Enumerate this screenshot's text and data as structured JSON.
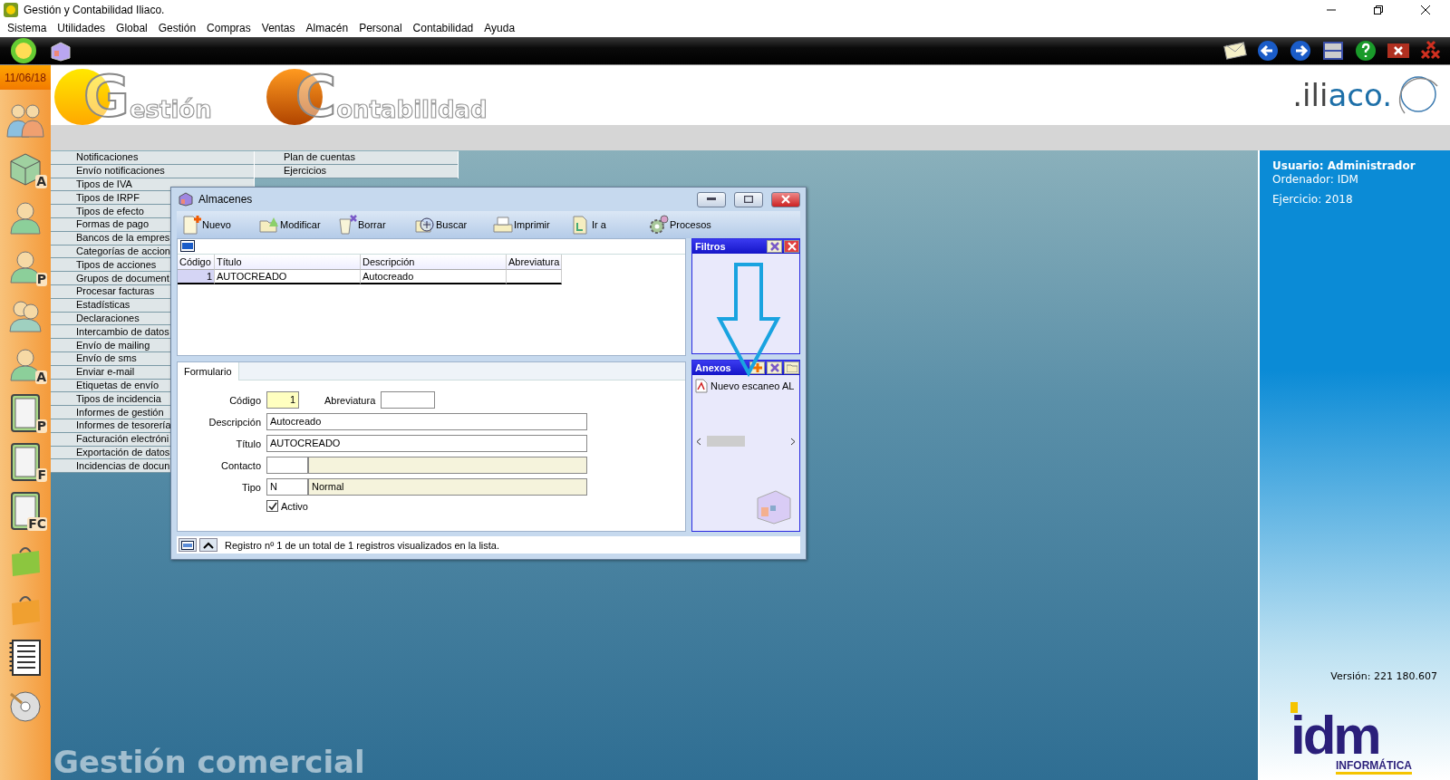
{
  "window": {
    "title": "Gestión y Contabilidad Iliaco."
  },
  "menu": [
    "Sistema",
    "Utilidades",
    "Global",
    "Gestión",
    "Compras",
    "Ventas",
    "Almacén",
    "Personal",
    "Contabilidad",
    "Ayuda"
  ],
  "date": "11/06/18",
  "sidebar_tiles": [
    {
      "kind": "group"
    },
    {
      "kind": "box",
      "letter": "A"
    },
    {
      "kind": "person"
    },
    {
      "kind": "person",
      "letter": "P"
    },
    {
      "kind": "pair"
    },
    {
      "kind": "person",
      "letter": "A"
    },
    {
      "kind": "card",
      "letter": "P"
    },
    {
      "kind": "card",
      "letter": "F"
    },
    {
      "kind": "card",
      "letter": "FC"
    },
    {
      "kind": "bag",
      "color": "#8cc63f"
    },
    {
      "kind": "bag",
      "color": "#f0a030"
    },
    {
      "kind": "notebook"
    },
    {
      "kind": "disc"
    }
  ],
  "logos": {
    "gestion": {
      "initial": "G",
      "rest": "estión"
    },
    "contabilidad": {
      "initial": "C",
      "rest": "ontabilidad"
    },
    "iliaco": {
      "dark": ".ili",
      "accent": "aco."
    }
  },
  "menu_columns": [
    [
      "Notificaciones",
      "Envío notificaciones",
      "Tipos de IVA",
      "Tipos de IRPF",
      "Tipos de efecto",
      "Formas de pago",
      "Bancos de la empres",
      "Categorías de accion",
      "Tipos de acciones",
      "Grupos de document",
      "Procesar facturas",
      "Estadísticas",
      "Declaraciones",
      "Intercambio de datos",
      "Envío de mailing",
      "Envío de sms",
      "Enviar e-mail",
      "Etiquetas de envío",
      "Tipos de incidencia",
      "Informes de gestión",
      "Informes de tesorería",
      "Facturación electróni",
      "Exportación de datos",
      "Incidencias de docun"
    ],
    [
      "Plan de cuentas",
      "Ejercicios"
    ]
  ],
  "footer_title": "Gestión comercial",
  "info_panel": {
    "user": "Usuario: Administrador",
    "computer": "Ordenador: IDM",
    "year": "Ejercicio: 2018",
    "version": "Versión: 221 180.607",
    "brand": {
      "name": "idm",
      "tagline": "INFORMÁTICA"
    }
  },
  "dialog": {
    "title": "Almacenes",
    "toolbar": [
      {
        "kind": "new",
        "label": "Nuevo"
      },
      {
        "kind": "edit",
        "label": "Modificar"
      },
      {
        "kind": "delete",
        "label": "Borrar"
      },
      {
        "kind": "search",
        "label": "Buscar"
      },
      {
        "kind": "print",
        "label": "Imprimir"
      },
      {
        "kind": "goto",
        "label": "Ir a"
      },
      {
        "kind": "process",
        "label": "Procesos"
      }
    ],
    "table": {
      "columns": [
        "Código",
        "Título",
        "Descripción",
        "Abreviatura"
      ],
      "rows": [
        {
          "code": "1",
          "title": "AUTOCREADO",
          "description": "Autocreado",
          "selected": true
        }
      ]
    },
    "tabs": [
      {
        "label": "Formulario",
        "selected": true
      }
    ],
    "form": {
      "code": {
        "label": "Código",
        "value": "1"
      },
      "abbreviation": {
        "label": "Abreviatura"
      },
      "description": {
        "label": "Descripción",
        "value": "Autocreado"
      },
      "title": {
        "label": "Título",
        "value": "AUTOCREADO"
      },
      "contact": {
        "label": "Contacto"
      },
      "type": {
        "label": "Tipo",
        "code": "N",
        "name": "Normal"
      },
      "active": {
        "label": "Activo",
        "checked": true
      }
    },
    "filters": {
      "title": "Filtros"
    },
    "attachments": {
      "title": "Anexos",
      "items": [
        "Nuevo escaneo AL"
      ]
    },
    "status": "Registro nº 1 de un total de 1 registros visualizados en la lista."
  }
}
